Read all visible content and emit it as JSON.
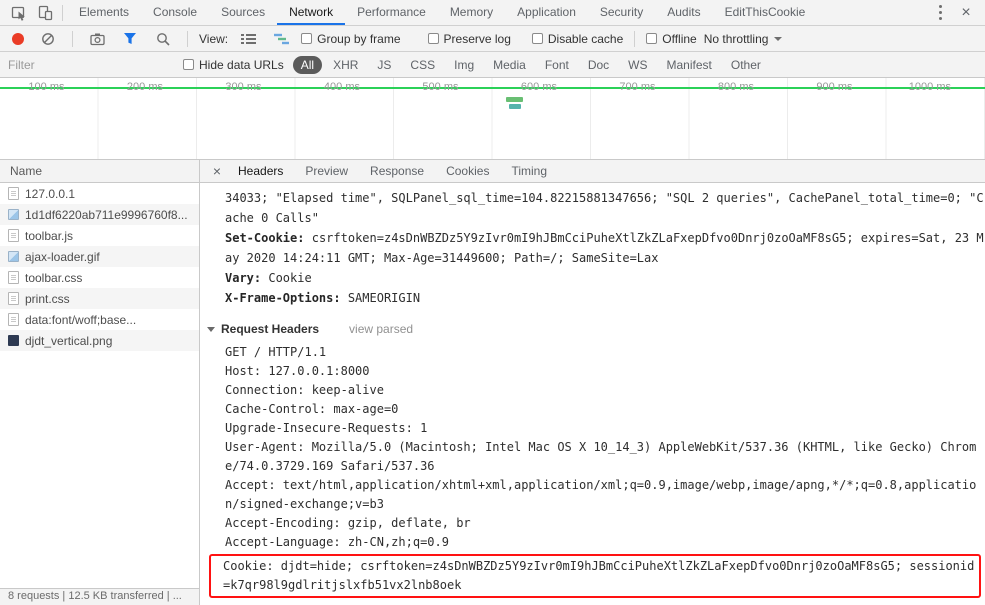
{
  "window": {
    "close_label": "×"
  },
  "main_tabs": [
    "Elements",
    "Console",
    "Sources",
    "Network",
    "Performance",
    "Memory",
    "Application",
    "Security",
    "Audits",
    "EditThisCookie"
  ],
  "toolbar": {
    "view_label": "View:",
    "group_by_frame_label": "Group by frame",
    "preserve_log_label": "Preserve log",
    "disable_cache_label": "Disable cache",
    "offline_label": "Offline",
    "throttling_value": "No throttling"
  },
  "filter_bar": {
    "placeholder": "Filter",
    "hide_data_urls_label": "Hide data URLs",
    "pills": [
      "All",
      "XHR",
      "JS",
      "CSS",
      "Img",
      "Media",
      "Font",
      "Doc",
      "WS",
      "Manifest",
      "Other"
    ],
    "active_pill": "All"
  },
  "timeline": {
    "ticks": [
      "100 ms",
      "200 ms",
      "300 ms",
      "400 ms",
      "500 ms",
      "600 ms",
      "700 ms",
      "800 ms",
      "900 ms",
      "1000 ms"
    ]
  },
  "request_list": {
    "column_header": "Name",
    "items": [
      {
        "name": "127.0.0.1",
        "type": "document"
      },
      {
        "name": "1d1df6220ab711e9996760f8...",
        "type": "image"
      },
      {
        "name": "toolbar.js",
        "type": "script"
      },
      {
        "name": "ajax-loader.gif",
        "type": "image"
      },
      {
        "name": "toolbar.css",
        "type": "stylesheet"
      },
      {
        "name": "print.css",
        "type": "stylesheet"
      },
      {
        "name": "data:font/woff;base...",
        "type": "font"
      },
      {
        "name": "djdt_vertical.png",
        "type": "image"
      }
    ]
  },
  "details": {
    "close_label": "×",
    "tabs": [
      "Headers",
      "Preview",
      "Response",
      "Cookies",
      "Timing"
    ],
    "active_tab": "Headers",
    "response_value_overflow": "34033; \"Elapsed time\", SQLPanel_sql_time=104.82215881347656; \"SQL 2 queries\", CachePanel_total_time=0; \"Cache 0 Calls\"",
    "response_headers": [
      {
        "name": "Set-Cookie:",
        "value": "csrftoken=z4sDnWBZDz5Y9zIvr0mI9hJBmCciPuheXtlZkZLaFxepDfvo0Dnrj0zoOaMF8sG5; expires=Sat, 23 May 2020 14:24:11 GMT; Max-Age=31449600; Path=/; SameSite=Lax"
      },
      {
        "name": "Vary:",
        "value": "Cookie"
      },
      {
        "name": "X-Frame-Options:",
        "value": "SAMEORIGIN"
      }
    ],
    "request_headers_title": "Request Headers",
    "view_parsed_label": "view parsed",
    "raw_request_headers": [
      "GET / HTTP/1.1",
      "Host: 127.0.0.1:8000",
      "Connection: keep-alive",
      "Cache-Control: max-age=0",
      "Upgrade-Insecure-Requests: 1",
      "User-Agent: Mozilla/5.0 (Macintosh; Intel Mac OS X 10_14_3) AppleWebKit/537.36 (KHTML, like Gecko) Chrome/74.0.3729.169 Safari/537.36",
      "Accept: text/html,application/xhtml+xml,application/xml;q=0.9,image/webp,image/apng,*/*;q=0.8,application/signed-exchange;v=b3",
      "Accept-Encoding: gzip, deflate, br",
      "Accept-Language: zh-CN,zh;q=0.9"
    ],
    "cookie_header": "Cookie: djdt=hide; csrftoken=z4sDnWBZDz5Y9zIvr0mI9hJBmCciPuheXtlZkZLaFxepDfvo0Dnrj0zoOaMF8sG5; sessionid=k7qr98l9gdlritjslxfb51vx2lnb8oek"
  },
  "status_bar": {
    "summary": "8 requests | 12.5 KB transferred | ..."
  },
  "colors": {
    "accent_blue": "#1a73e8",
    "record_red": "#ea3c26",
    "active_pill_bg": "#5b5b5b",
    "timeline_green": "#2bd158",
    "cookie_highlight_red": "#ff1212",
    "toolbar_bg": "#f3f3f3"
  }
}
